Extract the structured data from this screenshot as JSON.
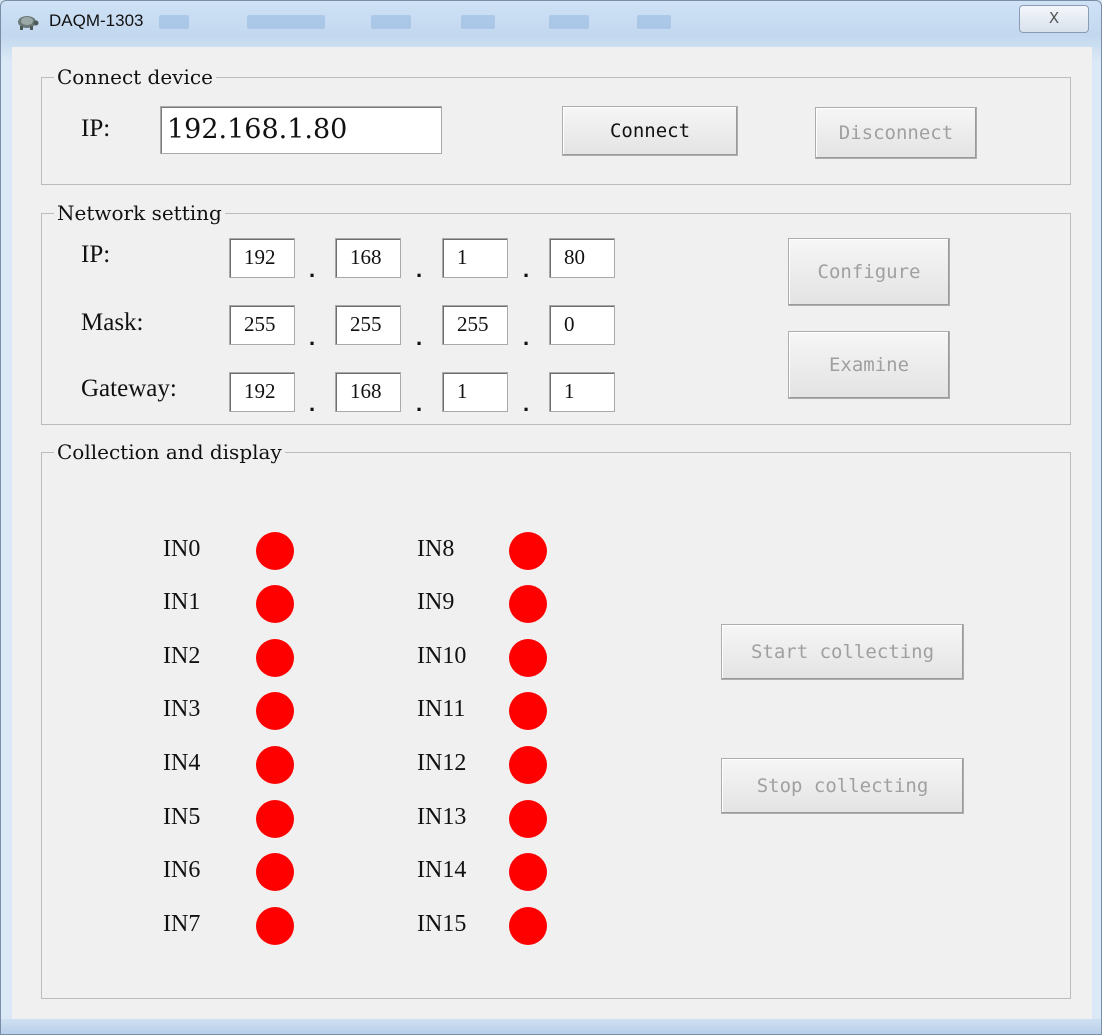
{
  "window": {
    "title": "DAQM-1303",
    "close_glyph": "X",
    "app_icon": "tortoise-icon"
  },
  "connect": {
    "group_label": "Connect device",
    "ip_label": "IP:",
    "ip_value": "192.168.1.80",
    "connect_label": "Connect",
    "disconnect_label": "Disconnect"
  },
  "network": {
    "group_label": "Network setting",
    "ip_label": "IP:",
    "mask_label": "Mask:",
    "gateway_label": "Gateway:",
    "ip": [
      "192",
      "168",
      "1",
      "80"
    ],
    "mask": [
      "255",
      "255",
      "255",
      "0"
    ],
    "gateway": [
      "192",
      "168",
      "1",
      "1"
    ],
    "separator": ".",
    "configure_label": "Configure",
    "examine_label": "Examine"
  },
  "collection": {
    "group_label": "Collection and display",
    "inputs_left": [
      "IN0",
      "IN1",
      "IN2",
      "IN3",
      "IN4",
      "IN5",
      "IN6",
      "IN7"
    ],
    "inputs_right": [
      "IN8",
      "IN9",
      "IN10",
      "IN11",
      "IN12",
      "IN13",
      "IN14",
      "IN15"
    ],
    "led_color": "#ff0000",
    "start_label": "Start collecting",
    "stop_label": "Stop collecting"
  }
}
